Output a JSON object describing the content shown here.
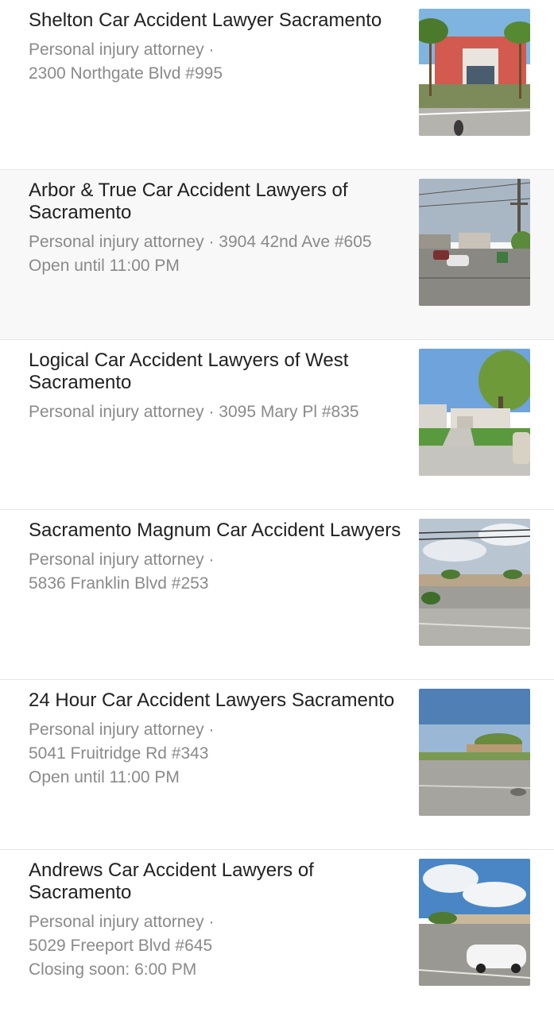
{
  "results": [
    {
      "name": "Shelton Car Accident Lawyer Sacramento",
      "lines": [
        "Personal injury attorney ·",
        "2300 Northgate Blvd #995"
      ],
      "highlighted": false,
      "thumb_icon": "street-view-photo"
    },
    {
      "name": "Arbor & True Car Accident Lawyers of Sacramento",
      "lines": [
        "Personal injury attorney · 3904 42nd Ave #605",
        "Open until 11:00 PM"
      ],
      "highlighted": true,
      "thumb_icon": "street-view-photo"
    },
    {
      "name": "Logical Car Accident Lawyers of West Sacramento",
      "lines": [
        "Personal injury attorney · 3095 Mary Pl #835"
      ],
      "highlighted": false,
      "thumb_icon": "street-view-photo"
    },
    {
      "name": "Sacramento Magnum Car Accident Lawyers",
      "lines": [
        "Personal injury attorney ·",
        "5836 Franklin Blvd #253"
      ],
      "highlighted": false,
      "thumb_icon": "street-view-photo"
    },
    {
      "name": "24 Hour Car Accident Lawyers Sacramento",
      "lines": [
        "Personal injury attorney ·",
        "5041 Fruitridge Rd #343",
        "Open until 11:00 PM"
      ],
      "highlighted": false,
      "thumb_icon": "street-view-photo"
    },
    {
      "name": "Andrews Car Accident Lawyers of Sacramento",
      "lines": [
        "Personal injury attorney ·",
        "5029 Freeport Blvd #645",
        "Closing soon: 6:00 PM"
      ],
      "highlighted": false,
      "thumb_icon": "street-view-photo"
    }
  ],
  "colors": {
    "title": "#212121",
    "meta": "#8a8a8a",
    "divider": "#e6e6e6",
    "highlight_bg": "#f8f8f8"
  }
}
